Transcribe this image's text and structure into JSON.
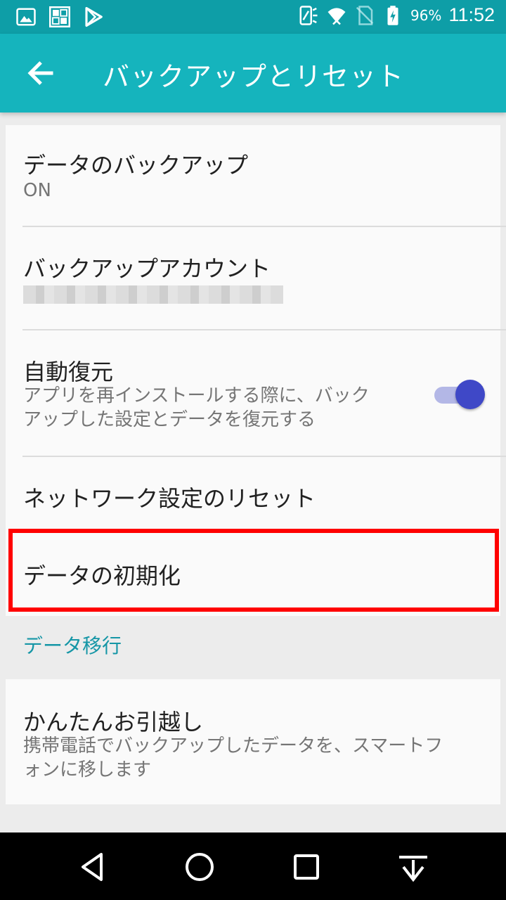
{
  "status_bar": {
    "left_icons": [
      "image-icon",
      "iconit-app-icon",
      "play-store-icon"
    ],
    "right_icons": [
      "nfc-icon",
      "wifi-icon",
      "no-sim-icon",
      "battery-charging-icon"
    ],
    "battery_percent": "96%",
    "time": "11:52"
  },
  "app_bar": {
    "back_icon": "arrow-left-icon",
    "title": "バックアップとリセット"
  },
  "settings": {
    "items": [
      {
        "title": "データのバックアップ",
        "subtitle": "ON"
      },
      {
        "title": "バックアップアカウント"
      },
      {
        "title": "自動復元",
        "subtitle_line1": "アプリを再インストールする際に、バック",
        "subtitle_line2": "アップした設定とデータを復元する",
        "toggle_on": true
      },
      {
        "title": "ネットワーク設定のリセット"
      },
      {
        "title": "データの初期化"
      }
    ]
  },
  "section": {
    "header": "データ移行",
    "item": {
      "title": "かんたんお引越し",
      "subtitle_line1": "携帯電話でバックアップしたデータを、スマートフ",
      "subtitle_line2": "ォンに移します"
    }
  },
  "nav_bar": {
    "buttons": [
      "back-triangle-icon",
      "home-circle-icon",
      "recents-square-icon",
      "hide-bar-icon"
    ]
  },
  "colors": {
    "status_bar": "#0e9ea7",
    "app_bar": "#15b4bd",
    "accent": "#3f48c7",
    "section_header": "#1596a6",
    "highlight": "#ff0000"
  }
}
